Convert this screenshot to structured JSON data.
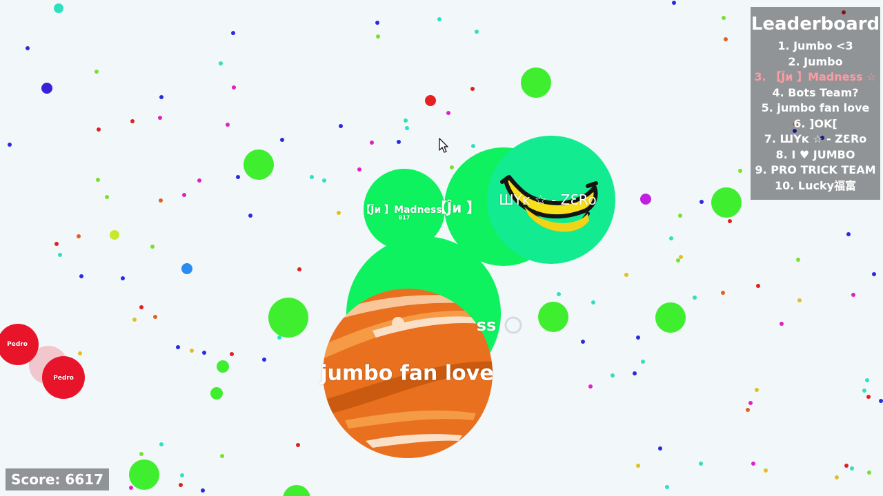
{
  "leaderboard": {
    "title": "Leaderboard",
    "entries": [
      {
        "rank": "1.",
        "name": "Jumbo <3"
      },
      {
        "rank": "2.",
        "name": "Jumbo"
      },
      {
        "rank": "3.",
        "name": "【Ĵи 】Madness ☆",
        "is_player": true
      },
      {
        "rank": "4.",
        "name": "Bots Team?"
      },
      {
        "rank": "5.",
        "name": "jumbo fan love"
      },
      {
        "rank": "6.",
        "name": "]OK["
      },
      {
        "rank": "7.",
        "name": "ШYĸ ☆ - ZƐRо"
      },
      {
        "rank": "8.",
        "name": "I ♥ JUMBO"
      },
      {
        "rank": "9.",
        "name": "PRO TRICK TEAM"
      },
      {
        "rank": "10.",
        "name": "Lucky福富"
      }
    ]
  },
  "score": {
    "label": "Score: 6617"
  },
  "cells": {
    "player_small": {
      "name": "【Ĵи 】Madness",
      "mass": "817"
    },
    "player_mid": {
      "name": "【Ĵи 】"
    },
    "zero": {
      "name": "ШYĸ ☆ - ZƐRо"
    },
    "player_large_fragment": {
      "name": "ss"
    },
    "jumbo_fan": {
      "name": "jumbo fan love"
    },
    "pedro_a": {
      "name": "Pedro"
    },
    "pedro_b": {
      "name": "Pedro"
    }
  },
  "colors": {
    "background": "#f2f7fa",
    "player_cell": "#0ef25f",
    "zero_cell": "#12eb8f",
    "food_virus_green": "#3ef03a",
    "jumbo_planet": "#e8701e",
    "pedro_cell": "#e8152a"
  },
  "icons": [
    "cursor-icon",
    "banana-icon",
    "planet-skin",
    "biohazard-icon"
  ]
}
